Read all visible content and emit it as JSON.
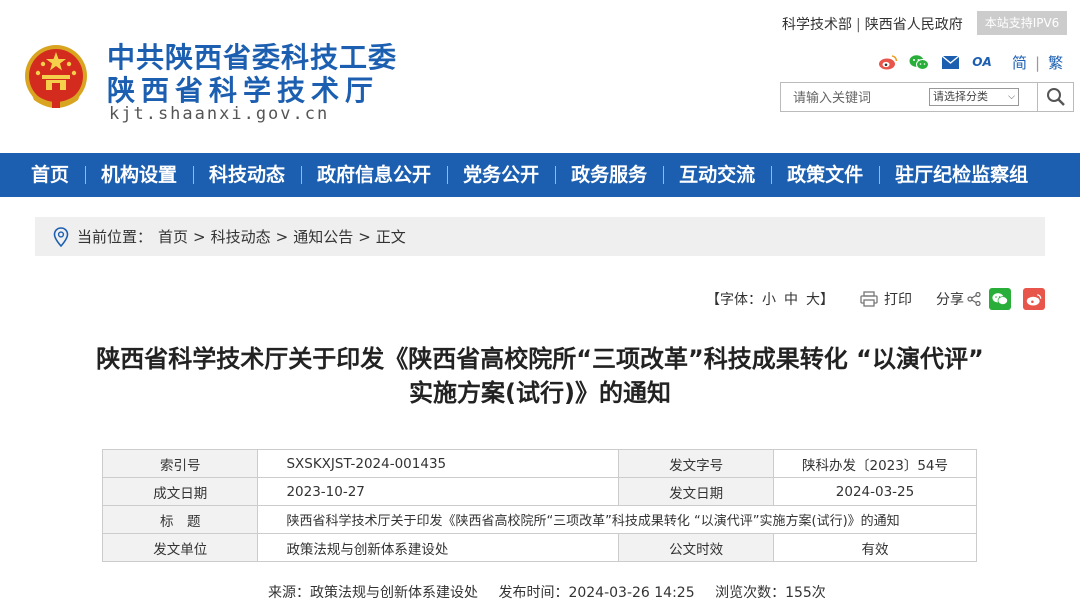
{
  "header": {
    "org_line1": "中共陕西省委科技工委",
    "org_line2": "陕西省科学技术厅",
    "site_url": "kjt.shaanxi.gov.cn",
    "top_links": [
      "科学技术部",
      "陕西省人民政府"
    ],
    "ipv6_label": "本站支持IPV6",
    "lang_simplified": "简",
    "lang_traditional": "繁",
    "social_icons": [
      "weibo-icon",
      "wechat-icon",
      "mail-icon",
      "oa-icon"
    ],
    "oa_label": "OA"
  },
  "search": {
    "placeholder": "请输入关键词",
    "category_label": "请选择分类"
  },
  "nav": {
    "items": [
      "首页",
      "机构设置",
      "科技动态",
      "政府信息公开",
      "党务公开",
      "政务服务",
      "互动交流",
      "政策文件",
      "驻厅纪检监察组"
    ]
  },
  "breadcrumb": {
    "prefix": "当前位置：",
    "items": [
      "首页",
      "科技动态",
      "通知公告",
      "正文"
    ],
    "separator": ">"
  },
  "tools": {
    "font_label": "【字体：",
    "font_small": "小",
    "font_medium": "中",
    "font_large": "大",
    "font_close": "】",
    "print_label": "打印",
    "share_label": "分享"
  },
  "article": {
    "title_line1": "陕西省科学技术厅关于印发《陕西省高校院所“三项改革”科技成果转化 “以演代评”",
    "title_line2": "实施方案(试行)》的通知"
  },
  "meta": {
    "index_no_label": "索引号",
    "index_no": "SXSKXJST-2024-001435",
    "doc_no_label": "发文字号",
    "doc_no": "陕科办发〔2023〕54号",
    "created_label": "成文日期",
    "created": "2023-10-27",
    "issued_label": "发文日期",
    "issued": "2024-03-25",
    "subject_label": "标　题",
    "subject": "陕西省科学技术厅关于印发《陕西省高校院所“三项改革”科技成果转化 “以演代评”实施方案(试行)》的通知",
    "unit_label": "发文单位",
    "unit": "政策法规与创新体系建设处",
    "validity_label": "公文时效",
    "validity": "有效"
  },
  "source": {
    "source": "来源：政策法规与创新体系建设处",
    "published": "发布时间：2024-03-26 14:25",
    "views": "浏览次数：155次"
  },
  "colors": {
    "brand_blue": "#1c5fb0",
    "wechat_green": "#2aae3a",
    "weibo_red": "#e8554a"
  }
}
